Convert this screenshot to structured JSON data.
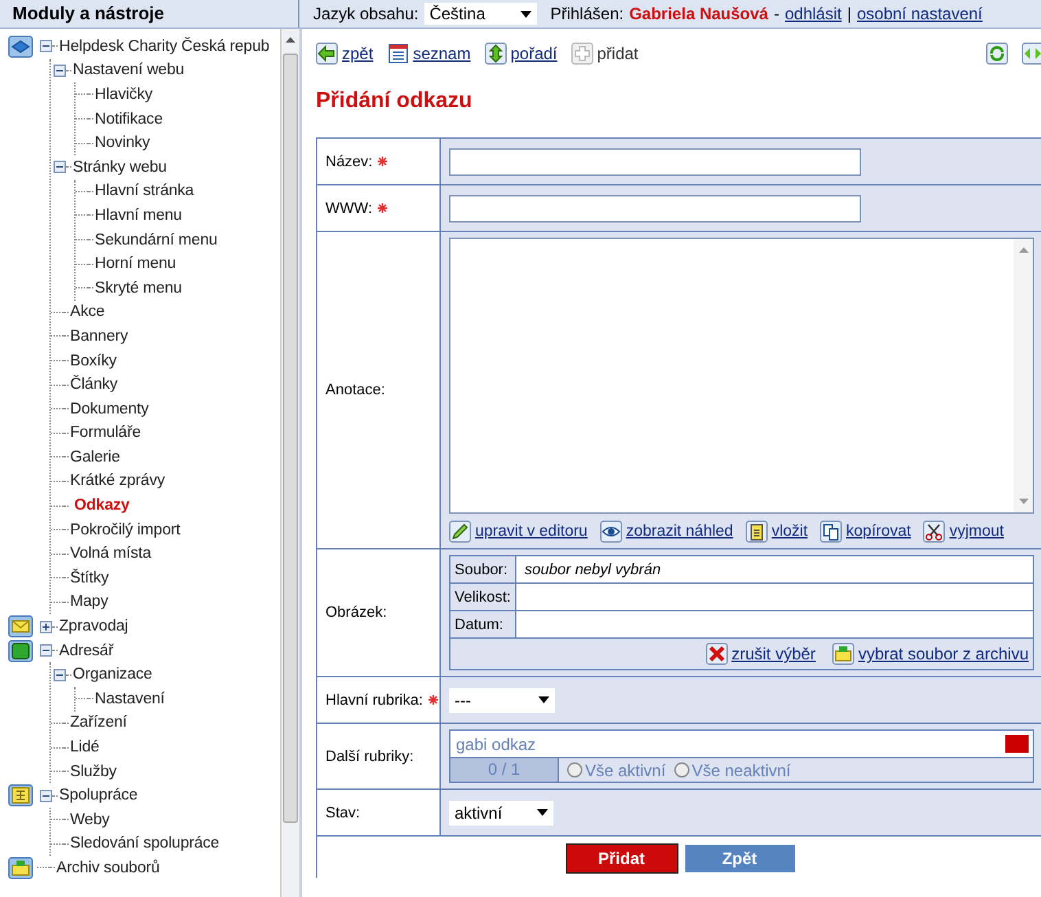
{
  "sidebar": {
    "title": "Moduly a nástroje",
    "tree": [
      {
        "label": "Helpdesk Charity Česká repub",
        "kind": "cube",
        "expanded": true,
        "selected": false,
        "children": [
          {
            "label": "Nastavení webu",
            "expanded": true,
            "selected": false,
            "children": [
              {
                "label": "Hlavičky",
                "selected": false
              },
              {
                "label": "Notifikace",
                "selected": false
              },
              {
                "label": "Novinky",
                "selected": false
              }
            ]
          },
          {
            "label": "Stránky webu",
            "expanded": true,
            "selected": false,
            "children": [
              {
                "label": "Hlavní stránka",
                "selected": false
              },
              {
                "label": "Hlavní menu",
                "selected": false
              },
              {
                "label": "Sekundární menu",
                "selected": false
              },
              {
                "label": "Horní menu",
                "selected": false
              },
              {
                "label": "Skryté menu",
                "selected": false
              }
            ]
          },
          {
            "label": "Akce",
            "selected": false
          },
          {
            "label": "Bannery",
            "selected": false
          },
          {
            "label": "Boxíky",
            "selected": false
          },
          {
            "label": "Články",
            "selected": false
          },
          {
            "label": "Dokumenty",
            "selected": false
          },
          {
            "label": "Formuláře",
            "selected": false
          },
          {
            "label": "Galerie",
            "selected": false
          },
          {
            "label": "Krátké zprávy",
            "selected": false
          },
          {
            "label": "Odkazy",
            "selected": true
          },
          {
            "label": "Pokročilý import",
            "selected": false
          },
          {
            "label": "Volná místa",
            "selected": false
          },
          {
            "label": "Štítky",
            "selected": false
          },
          {
            "label": "Mapy",
            "selected": false
          }
        ]
      },
      {
        "label": "Zpravodaj",
        "kind": "envelope",
        "expanded": false,
        "selected": false
      },
      {
        "label": "Adresář",
        "kind": "database",
        "expanded": true,
        "selected": false,
        "children": [
          {
            "label": "Organizace",
            "expanded": true,
            "selected": false,
            "children": [
              {
                "label": "Nastavení",
                "selected": false
              }
            ]
          },
          {
            "label": "Zařízení",
            "selected": false
          },
          {
            "label": "Lidé",
            "selected": false
          },
          {
            "label": "Služby",
            "selected": false
          }
        ]
      },
      {
        "label": "Spolupráce",
        "kind": "org",
        "expanded": true,
        "selected": false,
        "children": [
          {
            "label": "Weby",
            "selected": false
          },
          {
            "label": "Sledování spolupráce",
            "selected": false
          }
        ]
      },
      {
        "label": "Archiv souborů",
        "kind": "archive",
        "selected": false
      }
    ]
  },
  "topbar": {
    "language_label": "Jazyk obsahu:",
    "language": "Čeština",
    "logged_label": "Přihlášen:",
    "user": "Gabriela Naušová",
    "separator": "-",
    "logout": "odhlásit",
    "divider": "|",
    "settings": "osobní nastavení"
  },
  "toolbar": [
    {
      "label": "zpět",
      "kind": "back",
      "disabled": false
    },
    {
      "label": "seznam",
      "kind": "list",
      "disabled": false
    },
    {
      "label": "pořadí",
      "kind": "order",
      "disabled": false
    },
    {
      "label": "přidat",
      "kind": "add",
      "disabled": true
    }
  ],
  "title": "Přidání odkazu",
  "form": [
    {
      "label": "Název:",
      "required": true,
      "kind": "text"
    },
    {
      "label": "WWW:",
      "required": true,
      "kind": "text"
    },
    {
      "label": "Anotace:",
      "required": false,
      "kind": "textarea",
      "actions": [
        {
          "label": "upravit v editoru",
          "kind": "pencil"
        },
        {
          "label": "zobrazit náhled",
          "kind": "eye"
        },
        {
          "label": "vložit",
          "kind": "paste"
        },
        {
          "label": "kopírovat",
          "kind": "copy"
        },
        {
          "label": "vyjmout",
          "kind": "cut"
        }
      ]
    },
    {
      "label": "Obrázek:",
      "required": false,
      "kind": "image",
      "fields": [
        {
          "label": "Soubor:",
          "value": "soubor nebyl vybrán"
        },
        {
          "label": "Velikost:"
        },
        {
          "label": "Datum:"
        }
      ],
      "actions": [
        {
          "label": "zrušit výběr",
          "kind": "cancel"
        },
        {
          "label": "vybrat soubor z archivu",
          "kind": "archive"
        }
      ]
    },
    {
      "label": "Hlavní rubrika:",
      "required": true,
      "kind": "select",
      "value": "---"
    },
    {
      "label": "Další rubriky:",
      "required": false,
      "kind": "multi",
      "items": [
        {
          "label": "gabi odkaz"
        }
      ],
      "counter": "0 / 1",
      "radios": [
        {
          "label": "Vše aktivní",
          "selected": false
        },
        {
          "label": "Vše neaktivní",
          "selected": false
        }
      ]
    },
    {
      "label": "Stav:",
      "required": false,
      "kind": "select",
      "value": "aktivní"
    }
  ],
  "buttons": [
    {
      "label": "Přidat",
      "kind": "primary"
    },
    {
      "label": "Zpět",
      "kind": "secondary"
    }
  ]
}
